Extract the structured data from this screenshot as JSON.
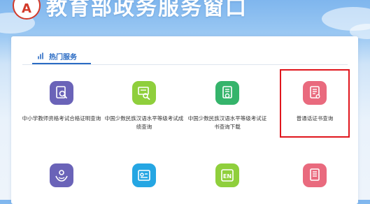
{
  "header": {
    "logo_char": "A",
    "title": "教育部政务服务窗口"
  },
  "hot_services": {
    "tab_label": "热门服务",
    "items": [
      {
        "label": "中小学教师资格考试合格证明查询",
        "icon": "teacher-certificate-search-icon",
        "color": "#6a63b8"
      },
      {
        "label": "中国少数民族汉语水平等级考试成绩查询",
        "icon": "exam-score-search-icon",
        "color": "#8fcf3c"
      },
      {
        "label": "中国少数民族汉语水平等级考试证书查询下载",
        "icon": "certificate-download-icon",
        "color": "#35b46b"
      },
      {
        "label": "普通话证书查询",
        "icon": "mandarin-certificate-icon",
        "color": "#e96a7e"
      },
      {
        "label": "",
        "icon": "student-care-icon",
        "color": "#6a63b8"
      },
      {
        "label": "",
        "icon": "id-card-icon",
        "color": "#25a6e3"
      },
      {
        "label": "",
        "icon": "english-exam-icon",
        "color": "#8fcf3c"
      },
      {
        "label": "",
        "icon": "document-icon",
        "color": "#e96a7e"
      }
    ]
  }
}
